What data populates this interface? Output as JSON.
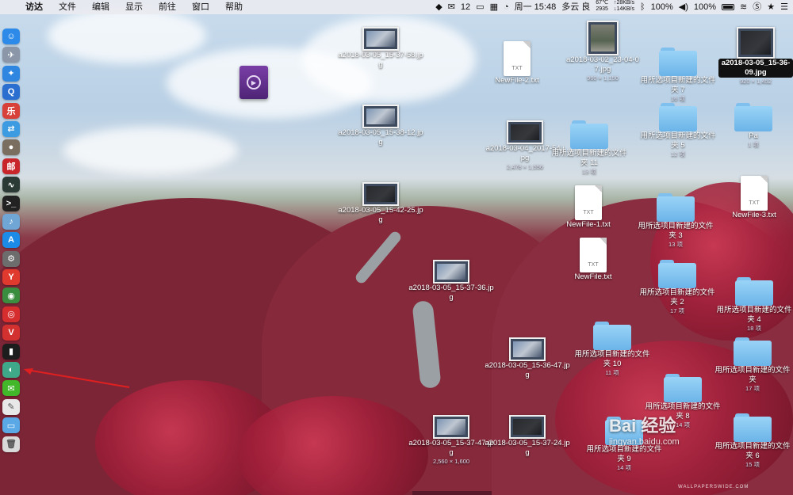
{
  "menubar": {
    "apple": "",
    "items": [
      "访达",
      "文件",
      "编辑",
      "显示",
      "前往",
      "窗口",
      "帮助"
    ],
    "status": {
      "wechat_count": "12",
      "time": "周一 15:48",
      "weather": "多云 良",
      "temp_line1": "67℃",
      "temp_line2": "2935",
      "net_up": "↑28KB/s",
      "net_down": "↓14KB/s",
      "volume": "100%",
      "battery": "100%"
    }
  },
  "dock": [
    {
      "name": "finder-icon",
      "color": "#2d8ae8",
      "glyph": "☺"
    },
    {
      "name": "launchpad-icon",
      "color": "#8b97a8",
      "glyph": "✈"
    },
    {
      "name": "safari-icon",
      "color": "#2f86e0",
      "glyph": "✦"
    },
    {
      "name": "search-app-icon",
      "color": "#2a6fd0",
      "glyph": "Q"
    },
    {
      "name": "app-red-icon",
      "color": "#d8403a",
      "glyph": "乐"
    },
    {
      "name": "migration-icon",
      "color": "#3d9be2",
      "glyph": "⇄"
    },
    {
      "name": "app-stone-icon",
      "color": "#7a6e60",
      "glyph": "●"
    },
    {
      "name": "mail-red-icon",
      "color": "#c8262b",
      "glyph": "邮"
    },
    {
      "name": "activity-icon",
      "color": "#2b3a35",
      "glyph": "∿"
    },
    {
      "name": "terminal-icon",
      "color": "#222",
      "glyph": ">_"
    },
    {
      "name": "dictation-icon",
      "color": "#6fa6d6",
      "glyph": "♪"
    },
    {
      "name": "app-store-icon",
      "color": "#1c8be8",
      "glyph": "A"
    },
    {
      "name": "system-prefs-icon",
      "color": "#6d6d6d",
      "glyph": "⚙"
    },
    {
      "name": "yandex-icon",
      "color": "#e03a2f",
      "glyph": "Y"
    },
    {
      "name": "chrome-icon",
      "color": "#3a8c3f",
      "glyph": "◉"
    },
    {
      "name": "netease-icon",
      "color": "#d62e2e",
      "glyph": "◎"
    },
    {
      "name": "vivaldi-icon",
      "color": "#d2312f",
      "glyph": "V"
    },
    {
      "name": "terminal-dark-icon",
      "color": "#1d1d1d",
      "glyph": "▮"
    },
    {
      "name": "app-green-icon",
      "color": "#3fa888",
      "glyph": "◐"
    },
    {
      "name": "wechat-icon",
      "color": "#42b72a",
      "glyph": "✉"
    },
    {
      "name": "notes-icon",
      "color": "#e8e8e8",
      "glyph": "✎"
    },
    {
      "name": "folder-dock-icon",
      "color": "#5aa9e6",
      "glyph": "▭"
    },
    {
      "name": "trash-icon",
      "color": "#d9d9d9",
      "glyph": "🗑"
    }
  ],
  "desktop": {
    "video": {
      "label": ""
    },
    "img1": {
      "label": "a2018-03-05_15-37-58.jpg"
    },
    "img2": {
      "label": "a2018-03-05_15-38-12.jpg"
    },
    "img3": {
      "label": "a2018-03-05_15-42-25.jpg"
    },
    "img4": {
      "label": "a2018-03-05_15-37-36.jpg"
    },
    "img5": {
      "label": "a2018-03-05_15-36-47.jpg"
    },
    "img6": {
      "label": "a2018-03-05_15-37-47.jpg",
      "sub": "2,560 × 1,600"
    },
    "img7": {
      "label": "a2018-03-05_15-37-24.jpg"
    },
    "img8": {
      "label": "a2018-03-04_2017-54.jpg",
      "sub": "2,478 × 1,556"
    },
    "img9": {
      "label": "a2018-03-02_23-04-07.jpg",
      "sub": "960 × 1,150"
    },
    "img10": {
      "label": "a2018-03-05_15-36-09.jpg",
      "sub": "920 × 1,452"
    },
    "txt1": {
      "label": "NewFile-2.txt",
      "ext": "TXT"
    },
    "txt2": {
      "label": "NewFile-1.txt",
      "ext": "TXT"
    },
    "txt3": {
      "label": "NewFile.txt",
      "ext": "TXT"
    },
    "txt4": {
      "label": "NewFile-3.txt",
      "ext": "TXT"
    },
    "f7": {
      "label": "用所选项目新建的文件夹 7",
      "sub": "16 项"
    },
    "f5": {
      "label": "用所选项目新建的文件夹 5",
      "sub": "12 项"
    },
    "f11": {
      "label": "用所选项目新建的文件夹 11",
      "sub": "13 项"
    },
    "fpa": {
      "label": "Pa",
      "sub": "1 项"
    },
    "f3": {
      "label": "用所选项目新建的文件夹 3",
      "sub": "13 项"
    },
    "f2": {
      "label": "用所选项目新建的文件夹 2",
      "sub": "17 项"
    },
    "f4": {
      "label": "用所选项目新建的文件夹 4",
      "sub": "18 项"
    },
    "f10": {
      "label": "用所选项目新建的文件夹 10",
      "sub": "11 项"
    },
    "f": {
      "label": "用所选项目新建的文件夹",
      "sub": "17 项"
    },
    "f8": {
      "label": "用所选项目新建的文件夹 8",
      "sub": "14 项"
    },
    "f9": {
      "label": "用所选项目新建的文件夹 9",
      "sub": "14 项"
    },
    "f6": {
      "label": "用所选项目新建的文件夹 6",
      "sub": "15 项"
    }
  },
  "watermark": {
    "logo": "Bai 经验",
    "url": "jingyan.baidu.com"
  },
  "credit": "WALLPAPERSWIDE.COM"
}
